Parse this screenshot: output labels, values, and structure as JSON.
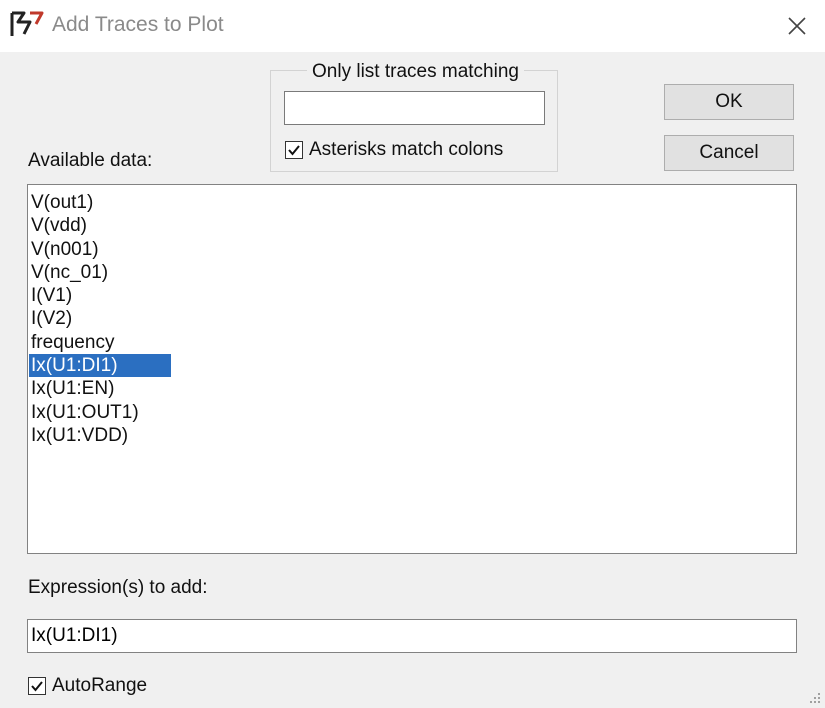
{
  "window": {
    "title": "Add Traces to Plot",
    "icon": "ltspice-app-icon",
    "close_icon": "close-icon"
  },
  "filter": {
    "group_label": "Only list traces matching",
    "input_value": "",
    "asterisks_label": "Asterisks match colons",
    "asterisks_checked": true
  },
  "buttons": {
    "ok_label": "OK",
    "cancel_label": "Cancel"
  },
  "available": {
    "label": "Available data:",
    "items": [
      "V(out1)",
      "V(vdd)",
      "V(n001)",
      "V(nc_01)",
      "I(V1)",
      "I(V2)",
      "frequency",
      "Ix(U1:DI1)",
      "Ix(U1:EN)",
      "Ix(U1:OUT1)",
      "Ix(U1:VDD)"
    ],
    "selected_index": 7
  },
  "expression": {
    "label": "Expression(s) to add:",
    "value": "Ix(U1:DI1)"
  },
  "autorange": {
    "label": "AutoRange",
    "checked": true
  },
  "colors": {
    "selection": "#2b6fc1",
    "title_text": "#8a8a8a",
    "background": "#f0f0f0"
  }
}
